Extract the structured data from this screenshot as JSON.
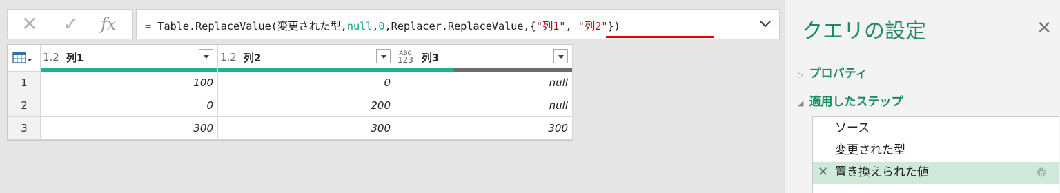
{
  "formula_bar": {
    "cancel_icon": "close-icon",
    "confirm_icon": "check-icon",
    "fx_label": "fx",
    "expr_prefix": "= Table.ReplaceValue(変更された型,",
    "expr_null": "null",
    "expr_mid1": ",",
    "expr_zero": "0",
    "expr_mid2": ",Replacer.ReplaceValue,{",
    "expr_str1": "\"列1\"",
    "expr_comma": ", ",
    "expr_str2": "\"列2\"",
    "expr_suffix": "})"
  },
  "grid": {
    "columns": [
      {
        "type": "1.2",
        "name": "列1",
        "quality_color": "#1ab394",
        "valid_fraction": 1.0
      },
      {
        "type": "1.2",
        "name": "列2",
        "quality_color": "#1ab394",
        "valid_fraction": 1.0
      },
      {
        "type": "ABC123",
        "type_top": "ABC",
        "type_bottom": "123",
        "name": "列3",
        "quality_color": "#1ab394",
        "valid_fraction": 0.33
      }
    ],
    "rows": [
      {
        "num": "1",
        "cells": [
          "100",
          "0",
          "null"
        ]
      },
      {
        "num": "2",
        "cells": [
          "0",
          "200",
          "null"
        ]
      },
      {
        "num": "3",
        "cells": [
          "300",
          "300",
          "300"
        ]
      }
    ]
  },
  "query_settings": {
    "title": "クエリの設定",
    "close_icon": "close-icon",
    "properties_label": "プロパティ",
    "applied_steps_label": "適用したステップ",
    "steps": [
      {
        "label": "ソース"
      },
      {
        "label": "変更された型"
      },
      {
        "label": "置き換えられた値"
      }
    ]
  },
  "colors": {
    "accent": "#1d8a5f",
    "selected_step": "#cfe9da",
    "quality_valid": "#1ab394",
    "quality_empty": "#6b6b6b",
    "highlight_underline": "#e00000"
  }
}
